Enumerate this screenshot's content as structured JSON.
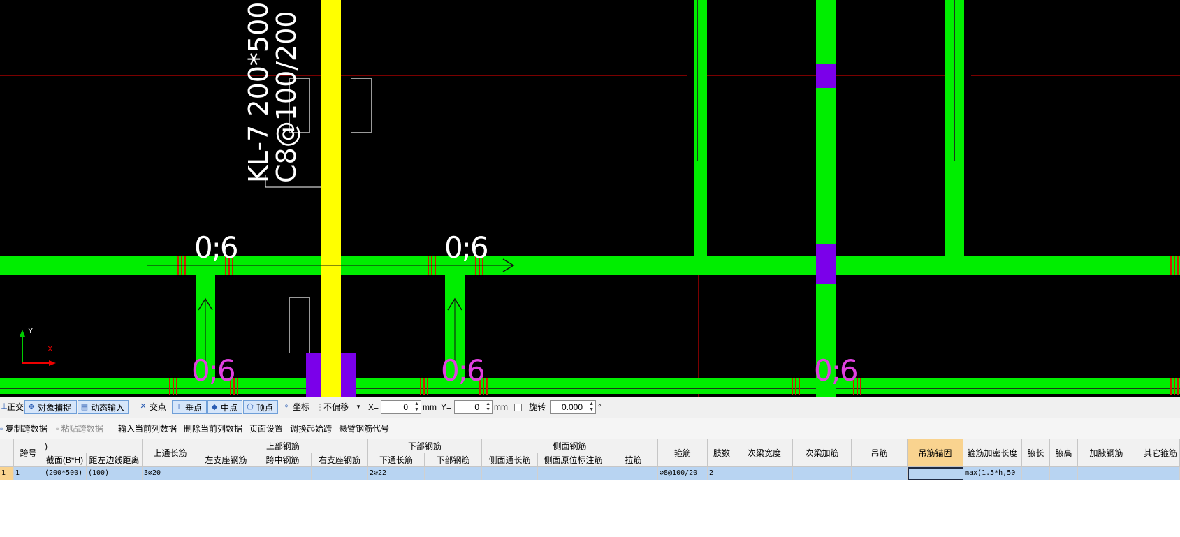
{
  "canvas": {
    "beam_label_line1": "KL-7 200*500",
    "beam_label_line2": "C8@100/200",
    "span_labels": [
      "0;6",
      "0;6",
      "0;6",
      "0;6",
      "0;6"
    ],
    "axis_y": "Y",
    "axis_x": "X",
    "colors": {
      "beam": "#00ee00",
      "column": "#ffff00",
      "support": "#7b00ea",
      "rebar_mark": "#cc2200",
      "grid_line": "#7a0000",
      "span_label": "#e040e0",
      "background": "#000000"
    }
  },
  "snap_toolbar": {
    "ortho": "正交",
    "object_snap": "对象捕捉",
    "dynamic_input": "动态输入",
    "intersection": "交点",
    "perpendicular": "垂点",
    "midpoint": "中点",
    "vertex": "顶点",
    "coordinate": "坐标",
    "offset_mode": "不偏移",
    "x_label": "X=",
    "x_value": "0",
    "x_unit": "mm",
    "y_label": "Y=",
    "y_value": "0",
    "y_unit": "mm",
    "rotate_label": "旋转",
    "rotate_value": "0.000",
    "degree": "°"
  },
  "table_toolbar": {
    "copy_span": "复制跨数据",
    "paste_span": "粘贴跨数据",
    "input_column": "输入当前列数据",
    "delete_column": "删除当前列数据",
    "page_setup": "页面设置",
    "swap_start": "调换起始跨",
    "cantilever_code": "悬臂钢筋代号"
  },
  "grid": {
    "header": {
      "span_no": "跨号",
      "collapsed": ")",
      "section": "截面(B*H)",
      "left_dist": "距左边线距离",
      "top_through": "上通长筋",
      "top_rebar": "上部钢筋",
      "left_support": "左支座钢筋",
      "mid_span": "跨中钢筋",
      "right_support": "右支座钢筋",
      "bottom_rebar": "下部钢筋",
      "bottom_through": "下通长筋",
      "bottom_bars": "下部钢筋",
      "side_rebar": "侧面钢筋",
      "side_through": "侧面通长筋",
      "side_original": "侧面原位标注筋",
      "tie_bar": "拉筋",
      "stirrup": "箍筋",
      "legs": "肢数",
      "sec_beam_width": "次梁宽度",
      "sec_beam_add": "次梁加筋",
      "hanger": "吊筋",
      "hanger_anchor": "吊筋锚固",
      "stirrup_dense": "箍筋加密长度",
      "haunch_len": "腋长",
      "haunch_height": "腋高",
      "haunch_rebar": "加腋钢筋",
      "other_stirrup": "其它箍筋"
    },
    "rows": [
      {
        "row_no": "1",
        "span_no": "1",
        "section": "(200*500)",
        "left_dist": "(100)",
        "top_through": "3⌀20",
        "left_support": "",
        "mid_span": "",
        "right_support": "",
        "bottom_through": "2⌀22",
        "bottom_bars": "",
        "side_through": "",
        "side_original": "",
        "tie_bar": "",
        "stirrup": "⌀8@100/20",
        "legs": "2",
        "sec_beam_width": "",
        "sec_beam_add": "",
        "hanger": "",
        "hanger_anchor": "",
        "stirrup_dense": "max(1.5*h,50",
        "haunch_len": "",
        "haunch_height": "",
        "haunch_rebar": "",
        "other_stirrup": ""
      }
    ]
  }
}
